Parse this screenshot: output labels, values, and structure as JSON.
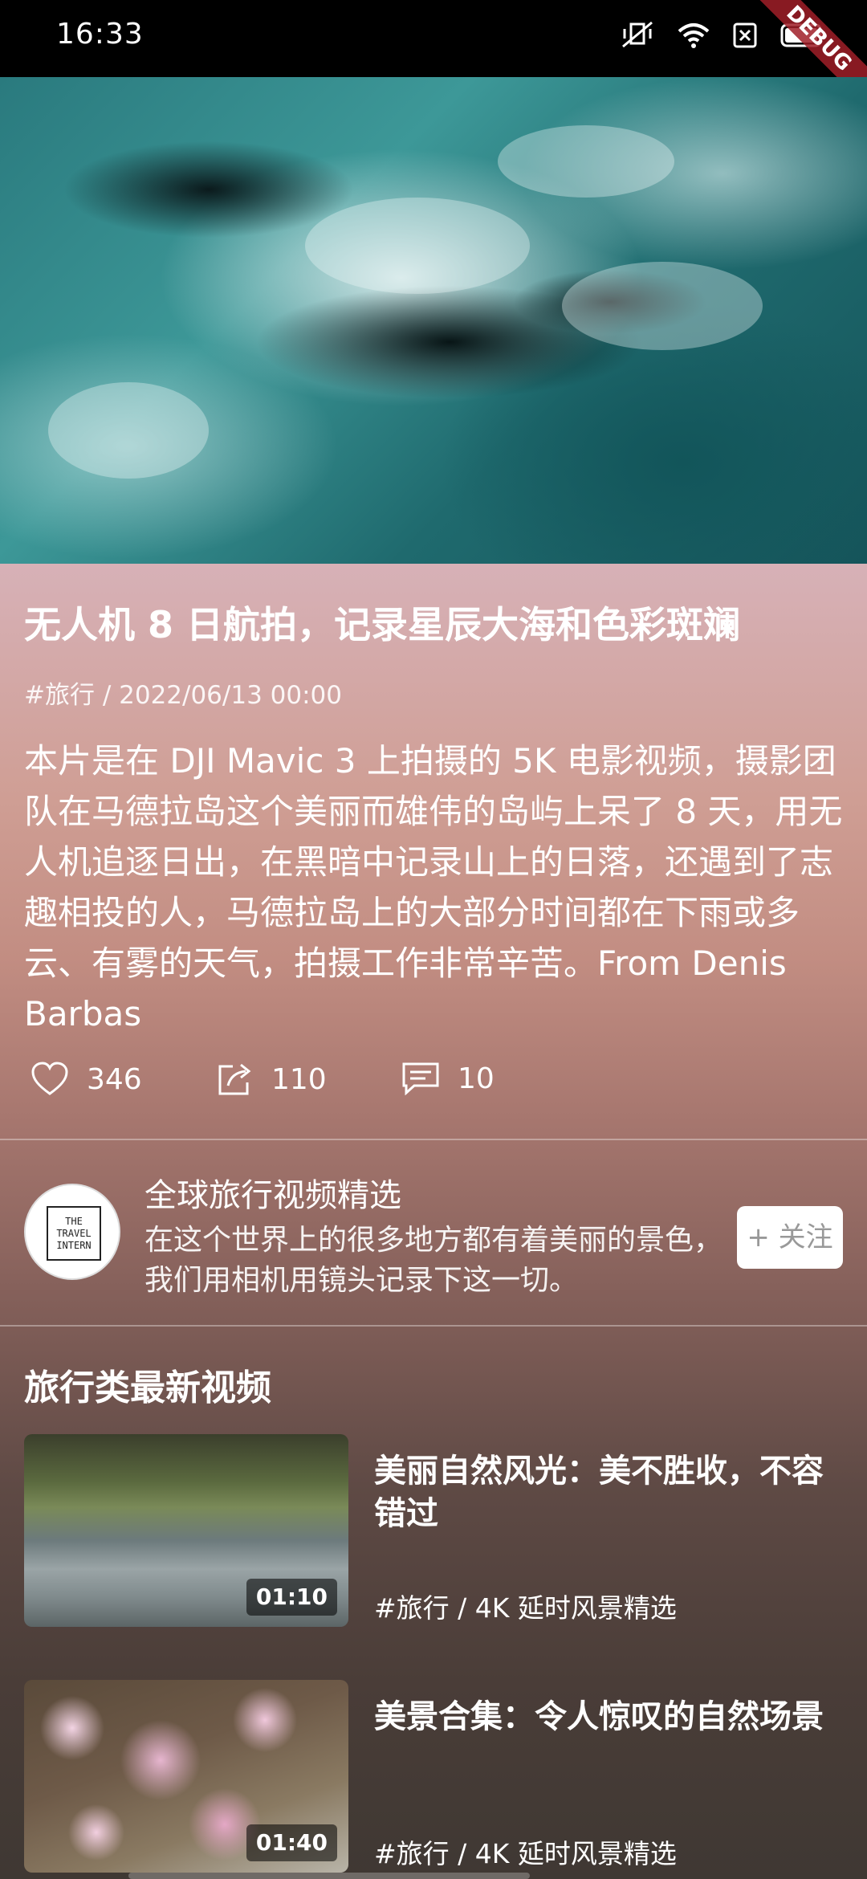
{
  "status_bar": {
    "time": "16:33",
    "icons": [
      "mute-vibrate-icon",
      "wifi-icon",
      "sim-off-icon",
      "battery-icon"
    ],
    "debug_label": "DEBUG"
  },
  "video": {
    "title": "无人机 8 日航拍，记录星辰大海和色彩斑斓",
    "meta": "#旅行 / 2022/06/13 00:00",
    "description": "本片是在 DJI Mavic 3 上拍摄的 5K 电影视频，摄影团队在马德拉岛这个美丽而雄伟的岛屿上呆了 8 天，用无人机追逐日出，在黑暗中记录山上的日落，还遇到了志趣相投的人，马德拉岛上的大部分时间都在下雨或多云、有雾的天气，拍摄工作非常辛苦。From Denis Barbas"
  },
  "actions": {
    "likes": "346",
    "shares": "110",
    "comments": "10"
  },
  "channel": {
    "avatar_text": [
      "THE",
      "TRAVEL",
      "INTERN"
    ],
    "name": "全球旅行视频精选",
    "description": "在这个世界上的很多地方都有着美丽的景色，我们用相机用镜头记录下这一切。",
    "follow_label": "+ 关注"
  },
  "section": {
    "title": "旅行类最新视频"
  },
  "related": [
    {
      "title": "美丽自然风光：美不胜收，不容错过",
      "meta": "#旅行 / 4K 延时风景精选",
      "duration": "01:10"
    },
    {
      "title": "美景合集：令人惊叹的自然场景",
      "meta": "#旅行 / 4K 延时风景精选",
      "duration": "01:40"
    }
  ],
  "colors": {
    "status_bar_bg": "#000000",
    "panel_top": "#d7b1b7",
    "panel_bottom": "#3f3833",
    "follow_bg": "#ffffff"
  }
}
